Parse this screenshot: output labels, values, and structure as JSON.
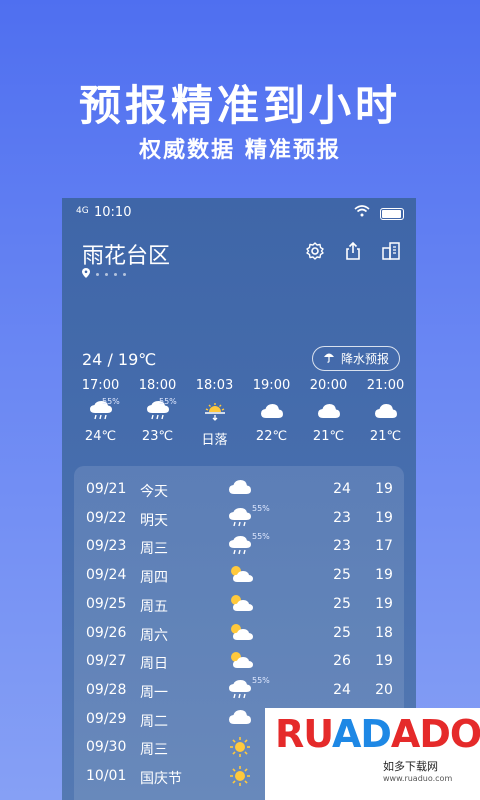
{
  "promo": {
    "headline": "预报精准到小时",
    "subline": "权威数据 精准预报"
  },
  "status": {
    "signal": "4G",
    "time": "10:10"
  },
  "location": {
    "city": "雨花台区"
  },
  "today": {
    "range": "24 / 19℃",
    "rain_forecast_label": "降水预报"
  },
  "hourly": [
    {
      "time": "17:00",
      "icon": "rain-cloud-icon",
      "pct": "55%",
      "temp": "24℃"
    },
    {
      "time": "18:00",
      "icon": "rain-cloud-icon",
      "pct": "55%",
      "temp": "23℃"
    },
    {
      "time": "18:03",
      "icon": "sunset-icon",
      "pct": "",
      "temp": "日落"
    },
    {
      "time": "19:00",
      "icon": "cloud-icon",
      "pct": "",
      "temp": "22℃"
    },
    {
      "time": "20:00",
      "icon": "cloud-icon",
      "pct": "",
      "temp": "21℃"
    },
    {
      "time": "21:00",
      "icon": "cloud-icon",
      "pct": "",
      "temp": "21℃"
    }
  ],
  "daily": [
    {
      "date": "09/21",
      "day": "今天",
      "icon": "cloud-icon",
      "pct": "",
      "hi": "24",
      "lo": "19"
    },
    {
      "date": "09/22",
      "day": "明天",
      "icon": "rain-cloud-icon",
      "pct": "55%",
      "hi": "23",
      "lo": "19"
    },
    {
      "date": "09/23",
      "day": "周三",
      "icon": "rain-cloud-icon",
      "pct": "55%",
      "hi": "23",
      "lo": "17"
    },
    {
      "date": "09/24",
      "day": "周四",
      "icon": "partly-cloudy-icon",
      "pct": "",
      "hi": "25",
      "lo": "19"
    },
    {
      "date": "09/25",
      "day": "周五",
      "icon": "partly-cloudy-icon",
      "pct": "",
      "hi": "25",
      "lo": "19"
    },
    {
      "date": "09/26",
      "day": "周六",
      "icon": "partly-cloudy-icon",
      "pct": "",
      "hi": "25",
      "lo": "18"
    },
    {
      "date": "09/27",
      "day": "周日",
      "icon": "partly-cloudy-icon",
      "pct": "",
      "hi": "26",
      "lo": "19"
    },
    {
      "date": "09/28",
      "day": "周一",
      "icon": "rain-cloud-icon",
      "pct": "55%",
      "hi": "24",
      "lo": "20"
    },
    {
      "date": "09/29",
      "day": "周二",
      "icon": "cloud-icon",
      "pct": "",
      "hi": "",
      "lo": ""
    },
    {
      "date": "09/30",
      "day": "周三",
      "icon": "sun-icon",
      "pct": "",
      "hi": "",
      "lo": ""
    },
    {
      "date": "10/01",
      "day": "国庆节",
      "icon": "sun-icon",
      "pct": "",
      "hi": "",
      "lo": ""
    }
  ],
  "watermark": {
    "logo_a": "RU",
    "logo_b": "AD",
    "logo_c": "ADO",
    "name": "如多下载网",
    "url": "www.ruaduo.com"
  },
  "colors": {
    "bg_top": "#4f6ff0",
    "card_bg": "#3f66a8",
    "sun": "#ffc93c"
  }
}
